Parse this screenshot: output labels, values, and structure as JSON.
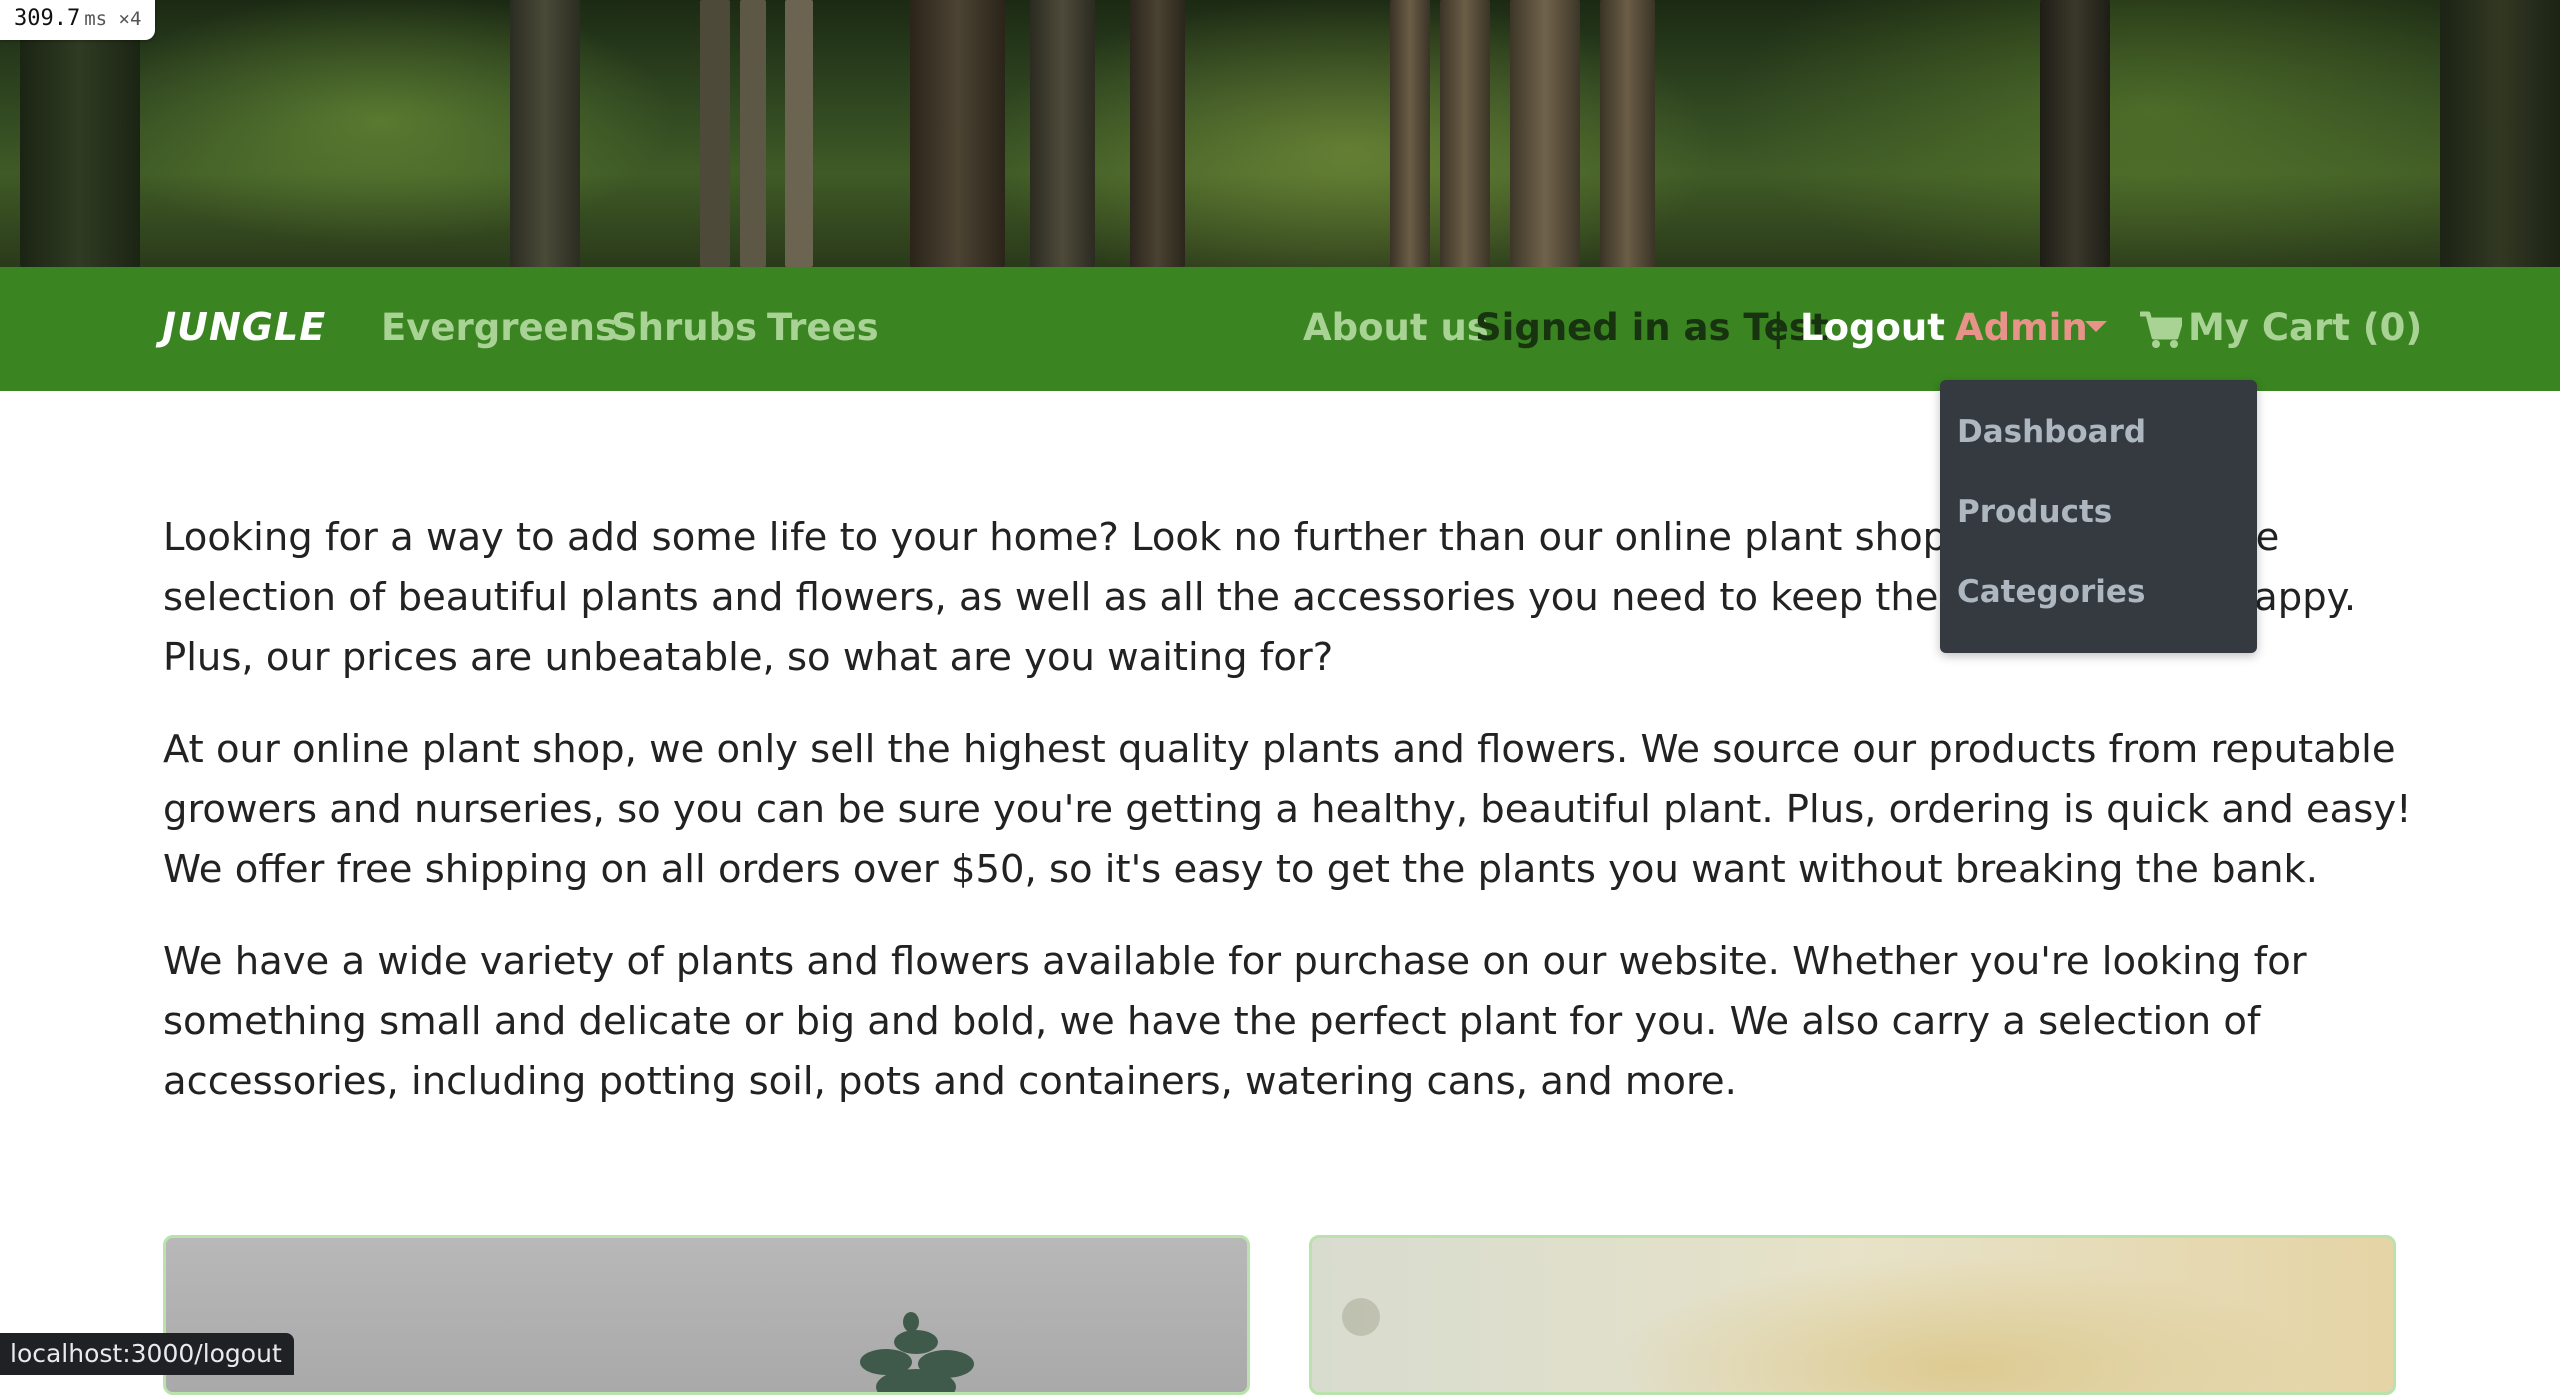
{
  "perf_overlay": {
    "time": "309.7",
    "unit": "ms ×4"
  },
  "navbar": {
    "brand": "JUNGLE",
    "categories": [
      "Evergreens",
      "Shrubs",
      "Trees"
    ],
    "about": "About us",
    "signed_in": "Signed in as Test",
    "separator": "|",
    "logout": "Logout",
    "admin": "Admin",
    "cart": "My Cart (0)",
    "colors": {
      "bar": "#3a8521",
      "link": "#a9d394",
      "admin": "#e8938a"
    }
  },
  "admin_menu": {
    "items": [
      "Dashboard",
      "Products",
      "Categories"
    ]
  },
  "intro": {
    "paragraphs": [
      "Looking for a way to add some life to your home? Look no further than our online plant shop! We have a wide selection of beautiful plants and flowers, as well as all the accessories you need to keep them healthy and happy. Plus, our prices are unbeatable, so what are you waiting for?",
      "At our online plant shop, we only sell the highest quality plants and flowers. We source our products from reputable growers and nurseries, so you can be sure you're getting a healthy, beautiful plant. Plus, ordering is quick and easy! We offer free shipping on all orders over $50, so it's easy to get the plants you want without breaking the bank.",
      "We have a wide variety of plants and flowers available for purchase on our website. Whether you're looking for something small and delicate or big and bold, we have the perfect plant for you. We also carry a selection of accessories, including potting soil, pots and containers, watering cans, and more."
    ]
  },
  "status_bar": {
    "url": "localhost:3000/logout"
  },
  "icons": {
    "cart": "shopping-cart-icon",
    "caret": "caret-down-icon"
  }
}
